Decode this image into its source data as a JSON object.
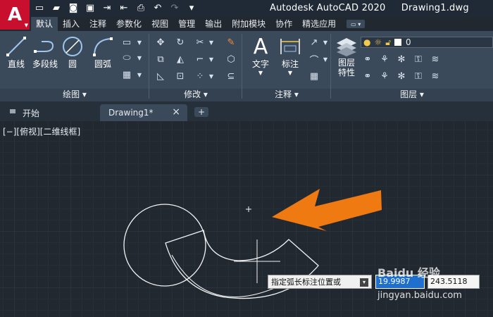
{
  "app": {
    "logo_letter": "A",
    "title": "Autodesk AutoCAD 2020",
    "document": "Drawing1.dwg"
  },
  "ribbon_tabs": [
    "默认",
    "插入",
    "注释",
    "参数化",
    "视图",
    "管理",
    "输出",
    "附加模块",
    "协作",
    "精选应用"
  ],
  "panels": {
    "draw": {
      "title": "绘图",
      "tools": [
        "直线",
        "多段线",
        "圆",
        "圆弧"
      ]
    },
    "modify": {
      "title": "修改"
    },
    "annotation": {
      "title": "注释",
      "tools": [
        "文字",
        "标注"
      ]
    },
    "layers": {
      "title": "图层",
      "tools": [
        "图层\n特性"
      ],
      "current_layer": "0"
    }
  },
  "doc_tabs": {
    "start": "开始",
    "drawing": "Drawing1*",
    "close": "×",
    "add": "+"
  },
  "viewport_label": "[−][俯视][二维线框]",
  "command": {
    "prompt": "指定弧长标注位置或",
    "value1": "19.9987",
    "value2": "243.5118"
  },
  "watermark": {
    "text": "Baidu 经验",
    "url": "jingyan.baidu.com"
  },
  "colors": {
    "arrow": "#f07a12",
    "accent": "#c8102e",
    "input_highlight": "#1e6fce"
  }
}
